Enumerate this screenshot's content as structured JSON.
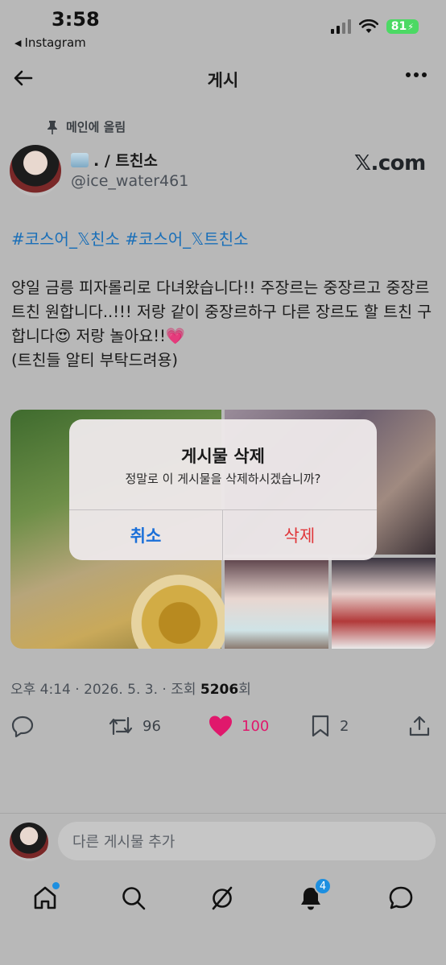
{
  "status_bar": {
    "time": "3:58",
    "back_app": "Instagram",
    "battery": "81"
  },
  "header": {
    "title": "게시"
  },
  "post": {
    "pinned_label": "메인에 올림",
    "author_name": ". / 트친소",
    "author_handle": "@ice_water461",
    "source_badge": "𝕏.com",
    "hashtags": "#코스어_𝕏친소 #코스어_𝕏트친소",
    "text": "양일 금릉 피자롤리로 다녀왔습니다!! 주장르는 중장르고 중장르 트친 원합니다..!!! 저랑 같이 중장르하구 다른 장르도 할 트친 구합니다😍 저랑 놀아요!!💗\n(트친들 알티 부탁드려용)",
    "meta_prefix": "오후 4:14 · 2026. 5. 3. · 조회 ",
    "views": "5206",
    "views_suffix": "회",
    "retweets": "96",
    "likes": "100",
    "bookmarks": "2"
  },
  "dialog": {
    "title": "게시물 삭제",
    "message": "정말로 이 게시물을 삭제하시겠습니까?",
    "cancel": "취소",
    "delete": "삭제"
  },
  "reply": {
    "placeholder": "다른 게시물 추가"
  },
  "nav": {
    "notifications_badge": "4"
  },
  "colors": {
    "accent": "#1a6fd8",
    "danger": "#e0363a",
    "like": "#e0186c",
    "background": "#b8b8b8"
  }
}
